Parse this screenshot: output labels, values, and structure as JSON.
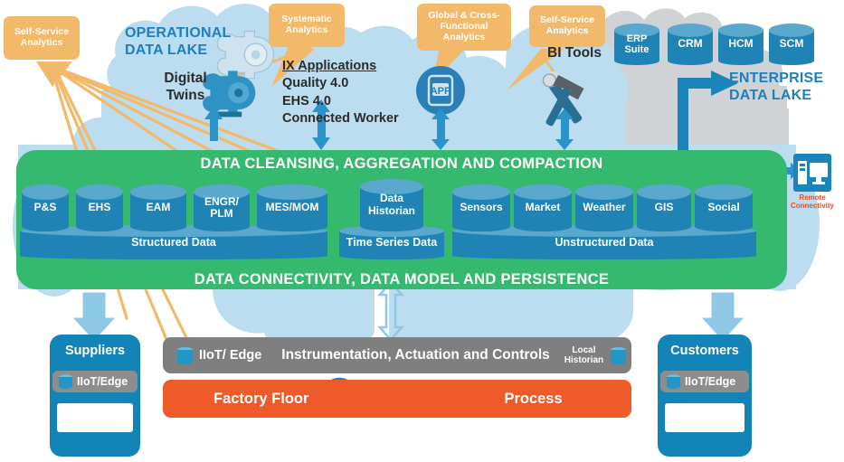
{
  "diagram": {
    "title": "Industrial Data Architecture",
    "colors": {
      "operational_cloud": "#bcdcef",
      "enterprise_cloud": "#cfd3d6",
      "green_band": "#34b96f",
      "callout_orange": "#f3b96a",
      "cylinder_blue": "#1f83b5",
      "cylinder_top": "#5aa8cd",
      "gray_bar": "#7f7f7f",
      "orange_bar": "#ef5a2b",
      "side_box_blue": "#1384b8",
      "arrow_blue": "#2a93c9",
      "lake_text": "#1b7fc0",
      "remote_label": "#e2502a"
    }
  },
  "callouts": [
    {
      "id": "self-service-left",
      "text": "Self-Service\nAnalytics"
    },
    {
      "id": "systematic",
      "text": "Systematic\nAnalytics"
    },
    {
      "id": "global-cross-functional",
      "text": "Global & Cross-\nFunctional\nAnalytics"
    },
    {
      "id": "self-service-right",
      "text": "Self-Service\nAnalytics"
    }
  ],
  "clouds": {
    "operational": {
      "title_line1": "OPERATIONAL",
      "title_line2": "DATA LAKE"
    },
    "enterprise": {
      "title_line1": "ENTERPRISE",
      "title_line2": "DATA LAKE"
    }
  },
  "top_items": {
    "digital_twins": {
      "line1": "Digital",
      "line2": "Twins",
      "icon": "pump-icon"
    },
    "ix_applications": {
      "heading": "IX Applications",
      "lines": [
        "Quality 4.0",
        "EHS 4.0",
        "Connected Worker"
      ]
    },
    "app": {
      "icon_label": "APP"
    },
    "bi_tools": {
      "label": "BI Tools",
      "icon": "wrench-hammer-icon"
    }
  },
  "enterprise_systems": [
    "ERP Suite",
    "CRM",
    "HCM",
    "SCM"
  ],
  "green_band": {
    "top_label": "DATA CLEANSING, AGGREGATION AND COMPACTION",
    "bottom_label": "DATA CONNECTIVITY, DATA MODEL AND PERSISTENCE"
  },
  "data_groups": [
    {
      "name": "Structured Data",
      "sources": [
        "P&S",
        "EHS",
        "EAM",
        "ENGR/ PLM",
        "MES/MOM"
      ]
    },
    {
      "name": "Time Series Data",
      "sources": [
        "Data Historian"
      ]
    },
    {
      "name": "Unstructured Data",
      "sources": [
        "Sensors",
        "Market",
        "Weather",
        "GIS",
        "Social"
      ]
    }
  ],
  "remote": {
    "label_line1": "Remote",
    "label_line2": "Connectivity",
    "icon": "monitor-tower-icon"
  },
  "bottom": {
    "suppliers": {
      "title": "Suppliers",
      "pill_label": "IIoT/Edge",
      "icons": [
        "gauge-device-icon",
        "truck-icon"
      ]
    },
    "customers": {
      "title": "Customers",
      "pill_label": "IIoT/Edge",
      "icons": [
        "valve-icon",
        "washer-appliance-icon"
      ]
    },
    "controls_bar": {
      "left_label": "IIoT/ Edge",
      "center_label": "Instrumentation, Actuation and Controls",
      "right_label": "Local\nHistorian"
    },
    "factory_bar": {
      "left_label": "Factory Floor",
      "right_label": "Process",
      "icons": [
        "worker-icon",
        "gauge-device-icon",
        "mobile-device-icon"
      ]
    }
  }
}
